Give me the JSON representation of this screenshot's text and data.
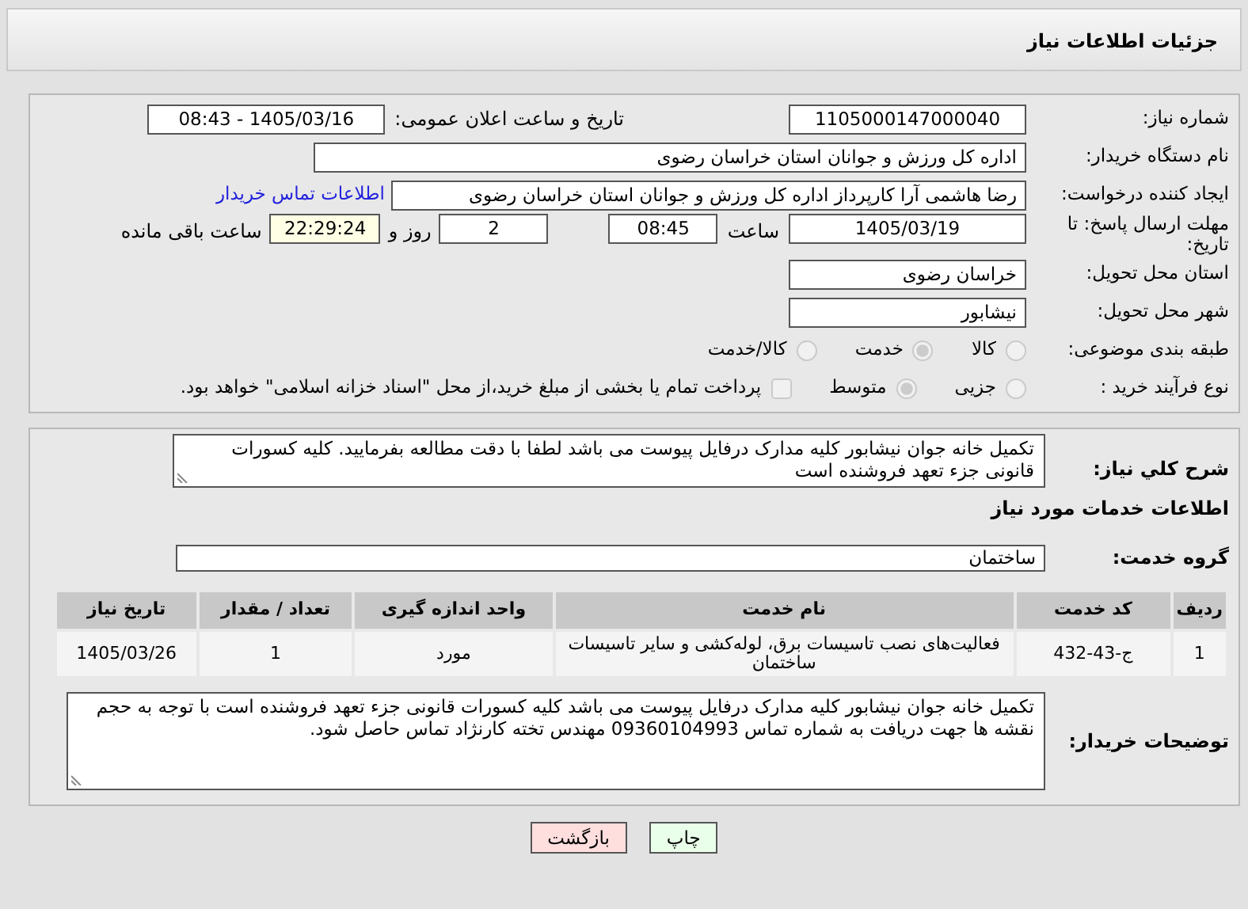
{
  "header": {
    "title": "جزئیات اطلاعات نیاز"
  },
  "need_number": {
    "label": "شماره نیاز:",
    "value": "1105000147000040"
  },
  "announce": {
    "label": "تاریخ و ساعت اعلان عمومی:",
    "value": "1405/03/16 - 08:43"
  },
  "buyer_org": {
    "label": "نام دستگاه خریدار:",
    "value": "اداره کل ورزش و جوانان استان خراسان رضوی"
  },
  "requester": {
    "label": "ایجاد کننده درخواست:",
    "value": "رضا هاشمی آرا کارپرداز اداره کل ورزش و جوانان استان خراسان رضوی",
    "link": "اطلاعات تماس خریدار"
  },
  "deadline": {
    "label": "مهلت ارسال پاسخ: تا تاریخ:",
    "date": "1405/03/19",
    "time_label": "ساعت",
    "time": "08:45",
    "days": "2",
    "days_label": "روز و",
    "remaining": "22:29:24",
    "remaining_label": "ساعت باقی مانده"
  },
  "province": {
    "label": "استان محل تحویل:",
    "value": "خراسان رضوی"
  },
  "city": {
    "label": "شهر محل تحویل:",
    "value": "نیشابور"
  },
  "category": {
    "label": "طبقه بندی موضوعی:",
    "options": [
      {
        "label": "کالا",
        "selected": false
      },
      {
        "label": "خدمت",
        "selected": true
      },
      {
        "label": "کالا/خدمت",
        "selected": false
      }
    ]
  },
  "process": {
    "label": "نوع فرآیند خرید :",
    "options": [
      {
        "label": "جزیی",
        "selected": false
      },
      {
        "label": "متوسط",
        "selected": true
      }
    ],
    "payment": {
      "label": "پرداخت تمام یا بخشی از مبلغ خرید،از محل \"اسناد خزانه اسلامی\" خواهد بود.",
      "checked": false
    }
  },
  "summary": {
    "label": "شرح کلي نياز:",
    "value": "تکمیل خانه جوان نیشابور کلیه مدارک درفایل پیوست می باشد لطفا با دقت مطالعه بفرمایید. کلیه کسورات قانونی جزء تعهد فروشنده است"
  },
  "services_title": "اطلاعات خدمات مورد نياز",
  "service_group": {
    "label": "گروه خدمت:",
    "value": "ساختمان"
  },
  "table": {
    "columns": [
      "ردیف",
      "کد خدمت",
      "نام خدمت",
      "واحد اندازه گیری",
      "تعداد / مقدار",
      "تاریخ نیاز"
    ],
    "rows": [
      [
        "1",
        "ج-43-432",
        "فعالیت‌های نصب تاسیسات برق، لوله‌کشی و سایر تاسیسات ساختمان",
        "مورد",
        "1",
        "1405/03/26"
      ]
    ]
  },
  "buyer_notes": {
    "label": "توضیحات خریدار:",
    "value": "تکمیل خانه جوان نیشابور کلیه مدارک درفایل پیوست می باشد کلیه کسورات قانونی جزء تعهد فروشنده است با توجه به حجم نقشه ها جهت دریافت به شماره تماس 09360104993 مهندس تخته کارنژاد تماس حاصل شود."
  },
  "buttons": [
    {
      "label": "چاپ",
      "kind": "print"
    },
    {
      "label": "بازگشت",
      "kind": "back"
    }
  ]
}
